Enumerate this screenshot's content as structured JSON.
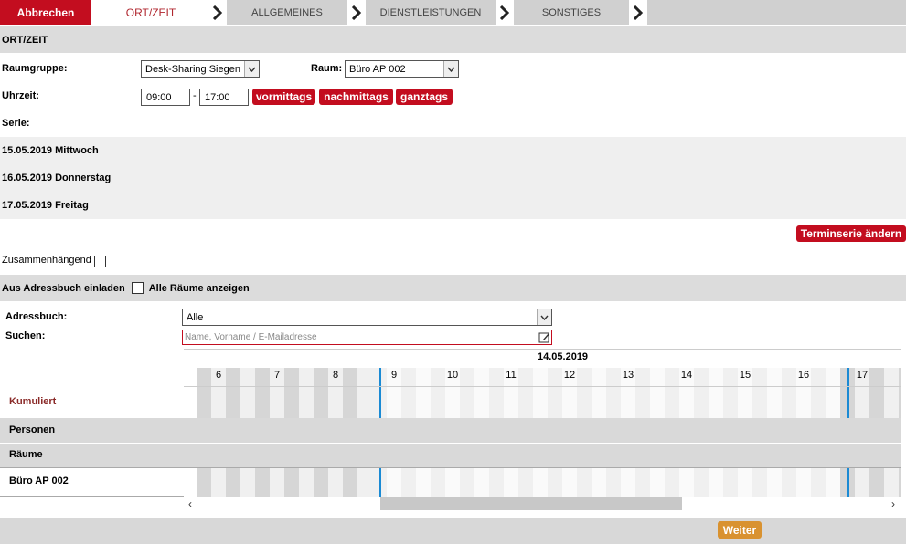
{
  "wizard": {
    "cancel_label": "Abbrechen",
    "steps": [
      "ORT/ZEIT",
      "ALLGEMEINES",
      "DIENSTLEISTUNGEN",
      "SONSTIGES"
    ]
  },
  "section": {
    "title": "ORT/ZEIT"
  },
  "form": {
    "raumgruppe_label": "Raumgruppe:",
    "raumgruppe_value": "Desk-Sharing Siegen",
    "raum_label": "Raum:",
    "raum_value": "Büro AP 002",
    "uhrzeit_label": "Uhrzeit:",
    "time_from": "09:00",
    "time_sep": "-",
    "time_to": "17:00",
    "btn_vormittags": "vormittags",
    "btn_nachmittags": "nachmittags",
    "btn_ganztags": "ganztags",
    "serie_label": "Serie:"
  },
  "series": [
    "15.05.2019 Mittwoch",
    "16.05.2019 Donnerstag",
    "17.05.2019 Freitag"
  ],
  "terminserie_button": "Terminserie ändern",
  "zusammenhaengend_label": "Zusammenhängend",
  "invite": {
    "label": "Aus Adressbuch einladen",
    "all_rooms_label": "Alle Räume anzeigen"
  },
  "address": {
    "adressbuch_label": "Adressbuch:",
    "adressbuch_value": "Alle",
    "suchen_label": "Suchen:",
    "search_placeholder": "Name, Vorname / E-Mailadresse"
  },
  "timeline": {
    "date": "14.05.2019",
    "hours": [
      "6",
      "7",
      "8",
      "9",
      "10",
      "11",
      "12",
      "13",
      "14",
      "15",
      "16",
      "17"
    ],
    "rows": [
      "Kumuliert",
      "Personen",
      "Räume",
      "Büro AP 002"
    ]
  },
  "footer": {
    "weiter_label": "Weiter"
  },
  "colors": {
    "accent_red": "#c30d1f",
    "orange": "#d99230",
    "marker_blue": "#1a8ad4"
  }
}
